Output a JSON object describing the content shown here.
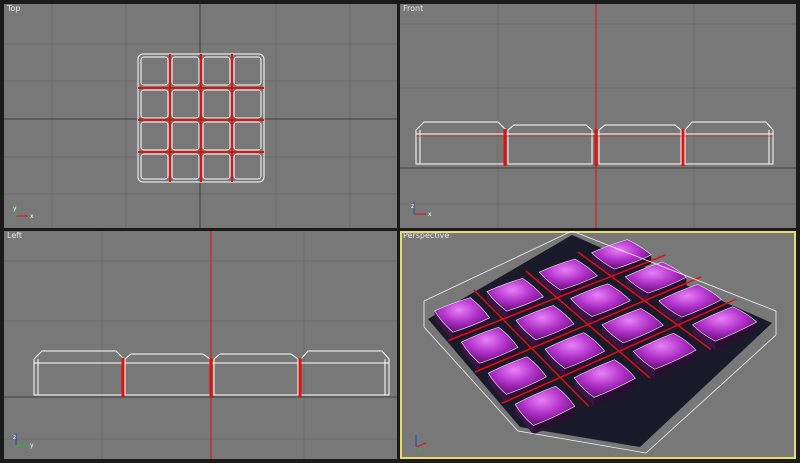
{
  "viewports": {
    "top": {
      "label": "Top"
    },
    "front": {
      "label": "Front"
    },
    "left": {
      "label": "Left"
    },
    "perspective": {
      "label": "Perspective"
    }
  },
  "colors": {
    "viewport_bg": "#787878",
    "grid": "#6a6a6a",
    "grid_major": "#4a4a4a",
    "wire": "#ffffff",
    "seam": "#e01010",
    "active_border": "#e8dc6a",
    "cushion": "#b030c8"
  },
  "axis_icons": [
    "z-axis-icon",
    "x-axis-icon",
    "y-axis-icon"
  ],
  "grid_layout": {
    "rows": 4,
    "cols": 4
  }
}
